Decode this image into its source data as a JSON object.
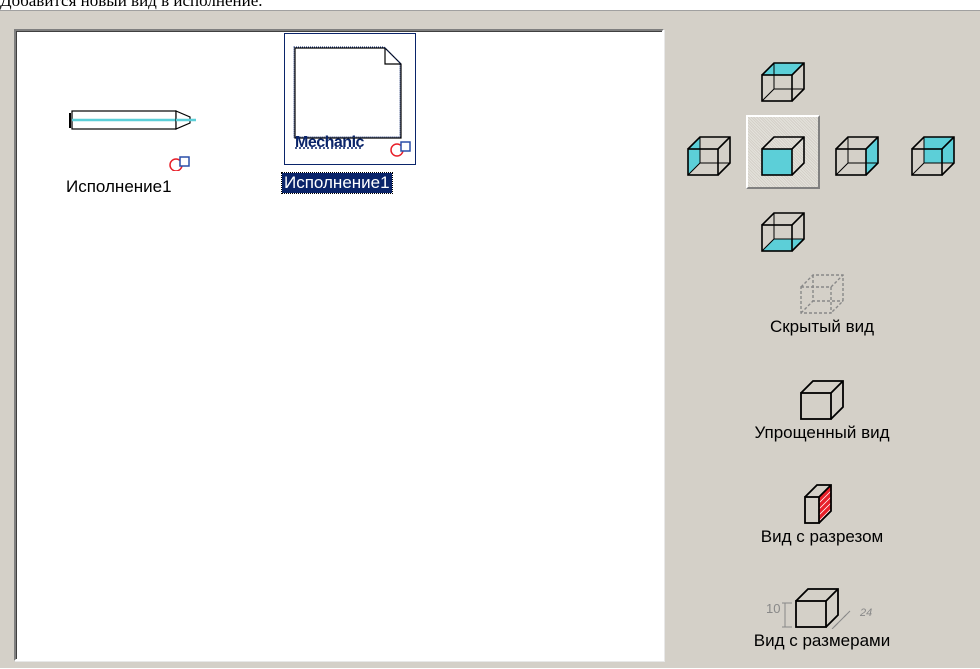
{
  "caption": "Добавится новый вид в исполнение.",
  "list": {
    "items": [
      {
        "label": "Исполнение1",
        "selected": false
      },
      {
        "label": "Исполнение1",
        "selected": true,
        "thumb_text": "Mechanic"
      }
    ]
  },
  "view_options": [
    {
      "label": "Скрытый вид"
    },
    {
      "label": "Упрощенный вид"
    },
    {
      "label": "Вид с разрезом"
    },
    {
      "label": "Вид с размерами",
      "dim_left": "10",
      "dim_right": "24"
    }
  ],
  "colors": {
    "accent_cyan": "#5ccfd8",
    "selection_bg": "#0a246a",
    "dialog_bg": "#d4d0c8",
    "section_red": "#e8202a"
  }
}
